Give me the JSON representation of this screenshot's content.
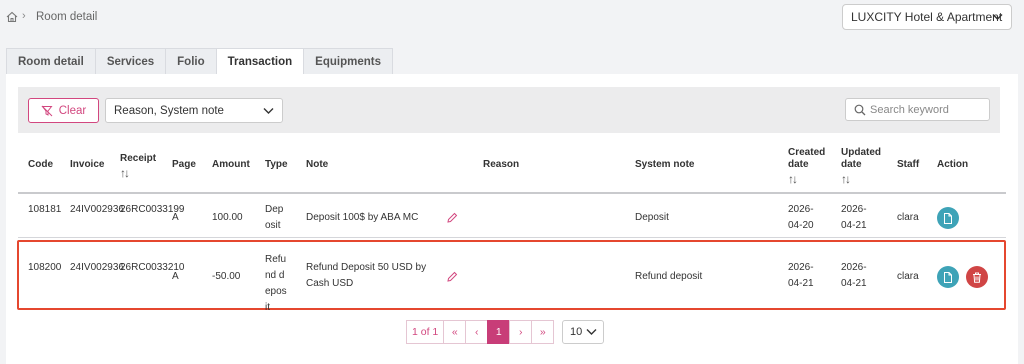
{
  "breadcrumb": {
    "current": "Room detail"
  },
  "hotel_select": {
    "value": "LUXCITY Hotel & Apartment"
  },
  "tabs": [
    {
      "label": "Room detail"
    },
    {
      "label": "Services"
    },
    {
      "label": "Folio"
    },
    {
      "label": "Transaction"
    },
    {
      "label": "Equipments"
    }
  ],
  "toolbar": {
    "clear_label": "Clear",
    "filter_value": "Reason, System note",
    "search_placeholder": "Search keyword"
  },
  "table": {
    "headers": {
      "code": "Code",
      "invoice": "Invoice",
      "receipt": "Receipt",
      "page": "Page",
      "amount": "Amount",
      "type": "Type",
      "note": "Note",
      "reason": "Reason",
      "system_note": "System note",
      "created": "Created date",
      "updated": "Updated date",
      "staff": "Staff",
      "action": "Action"
    },
    "sort_glyph": "↑↓",
    "rows": [
      {
        "code": "108181",
        "invoice": "24IV002936",
        "receipt": "26RC0033199",
        "page": "A",
        "amount": "100.00",
        "type": "Deposit",
        "note": "Deposit 100$ by ABA MC",
        "reason": "",
        "system_note": "Deposit",
        "created": "2026-04-20",
        "updated": "2026-04-21",
        "staff": "clara"
      },
      {
        "code": "108200",
        "invoice": "24IV002936",
        "receipt": "26RC0033210",
        "page": "A",
        "amount": "-50.00",
        "type": "Refund deposit",
        "note": "Refund Deposit 50 USD by Cash USD",
        "reason": "",
        "system_note": "Refund deposit",
        "created": "2026-04-21",
        "updated": "2026-04-21",
        "staff": "clara"
      }
    ]
  },
  "pagination": {
    "info": "1 of 1",
    "first": "«",
    "prev": "‹",
    "current": "1",
    "next": "›",
    "last": "»",
    "page_size": "10"
  },
  "colors": {
    "accent": "#d2477f",
    "teal": "#3ea3b7",
    "danger": "#d04545",
    "highlight": "#e5472f"
  }
}
